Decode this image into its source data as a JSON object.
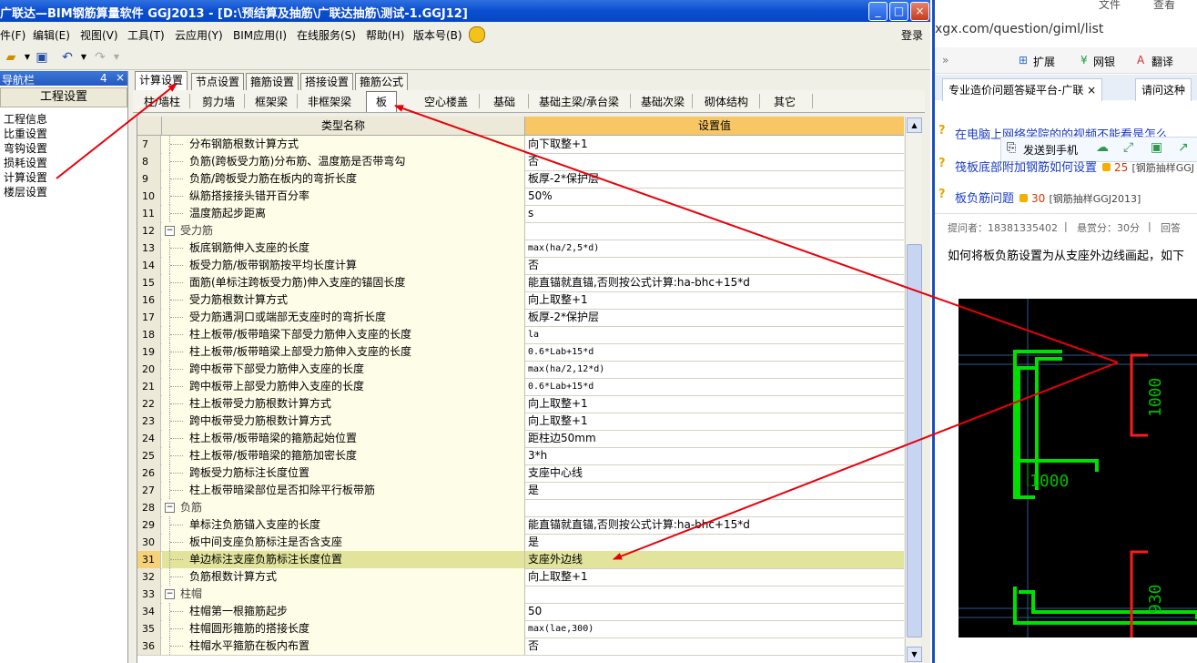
{
  "window": {
    "title": "广联达—BIM钢筋算量软件 GGJ2013 - [D:\\预结算及抽筋\\广联达抽筋\\测试-1.GGJ12]",
    "minimize": "_",
    "maximize": "□",
    "close": "×"
  },
  "menubar": {
    "items": [
      "件(F)",
      "编辑(E)",
      "视图(V)",
      "工具(T)",
      "云应用(Y)",
      "BIM应用(I)",
      "在线服务(S)",
      "帮助(H)",
      "版本号(B)"
    ],
    "login": "登录"
  },
  "nav": {
    "title": "导航栏",
    "pin": "4",
    "close": "×",
    "section": "工程设置",
    "items": [
      "工程信息",
      "比重设置",
      "弯钩设置",
      "损耗设置",
      "计算设置",
      "楼层设置"
    ]
  },
  "tabs": [
    "计算设置",
    "节点设置",
    "箍筋设置",
    "搭接设置",
    "箍筋公式"
  ],
  "subtabs": [
    "柱/墙柱",
    "剪力墙",
    "框架梁",
    "非框架梁",
    "板",
    "空心楼盖",
    "基础",
    "基础主梁/承台梁",
    "基础次梁",
    "砌体结构",
    "其它"
  ],
  "grid": {
    "header_name": "类型名称",
    "header_value": "设置值",
    "rows": [
      {
        "num": "7",
        "name": "分布钢筋根数计算方式",
        "value": "向下取整+1"
      },
      {
        "num": "8",
        "name": "负筋(跨板受力筋)分布筋、温度筋是否带弯勾",
        "value": "否"
      },
      {
        "num": "9",
        "name": "负筋/跨板受力筋在板内的弯折长度",
        "value": "板厚-2*保护层"
      },
      {
        "num": "10",
        "name": "纵筋搭接接头错开百分率",
        "value": "50%"
      },
      {
        "num": "11",
        "name": "温度筋起步距离",
        "value": "s"
      },
      {
        "num": "12",
        "name": "受力筋",
        "value": "",
        "group": true
      },
      {
        "num": "13",
        "name": "板底钢筋伸入支座的长度",
        "value": "max(ha/2,5*d)",
        "mono": true
      },
      {
        "num": "14",
        "name": "板受力筋/板带钢筋按平均长度计算",
        "value": "否"
      },
      {
        "num": "15",
        "name": "面筋(单标注跨板受力筋)伸入支座的锚固长度",
        "value": "能直锚就直锚,否则按公式计算:ha-bhc+15*d"
      },
      {
        "num": "16",
        "name": "受力筋根数计算方式",
        "value": "向上取整+1"
      },
      {
        "num": "17",
        "name": "受力筋遇洞口或端部无支座时的弯折长度",
        "value": "板厚-2*保护层"
      },
      {
        "num": "18",
        "name": "柱上板带/板带暗梁下部受力筋伸入支座的长度",
        "value": "la",
        "mono": true
      },
      {
        "num": "19",
        "name": "柱上板带/板带暗梁上部受力筋伸入支座的长度",
        "value": "0.6*Lab+15*d",
        "mono": true
      },
      {
        "num": "20",
        "name": "跨中板带下部受力筋伸入支座的长度",
        "value": "max(ha/2,12*d)",
        "mono": true
      },
      {
        "num": "21",
        "name": "跨中板带上部受力筋伸入支座的长度",
        "value": "0.6*Lab+15*d",
        "mono": true
      },
      {
        "num": "22",
        "name": "柱上板带受力筋根数计算方式",
        "value": "向上取整+1"
      },
      {
        "num": "23",
        "name": "跨中板带受力筋根数计算方式",
        "value": "向上取整+1"
      },
      {
        "num": "24",
        "name": "柱上板带/板带暗梁的箍筋起始位置",
        "value": "距柱边50mm"
      },
      {
        "num": "25",
        "name": "柱上板带/板带暗梁的箍筋加密长度",
        "value": "3*h"
      },
      {
        "num": "26",
        "name": "跨板受力筋标注长度位置",
        "value": "支座中心线"
      },
      {
        "num": "27",
        "name": "柱上板带暗梁部位是否扣除平行板带筋",
        "value": "是"
      },
      {
        "num": "28",
        "name": "负筋",
        "value": "",
        "group": true
      },
      {
        "num": "29",
        "name": "单标注负筋锚入支座的长度",
        "value": "能直锚就直锚,否则按公式计算:ha-bhc+15*d"
      },
      {
        "num": "30",
        "name": "板中间支座负筋标注是否含支座",
        "value": "是"
      },
      {
        "num": "31",
        "name": "单边标注支座负筋标注长度位置",
        "value": "支座外边线",
        "selected": true
      },
      {
        "num": "32",
        "name": "负筋根数计算方式",
        "value": "向上取整+1"
      },
      {
        "num": "33",
        "name": "柱帽",
        "value": "",
        "group": true
      },
      {
        "num": "34",
        "name": "柱帽第一根箍筋起步",
        "value": "50"
      },
      {
        "num": "35",
        "name": "柱帽圆形箍筋的搭接长度",
        "value": "max(lae,300)",
        "mono": true
      },
      {
        "num": "36",
        "name": "柱帽水平箍筋在板内布置",
        "value": "否"
      }
    ]
  },
  "browser": {
    "menu_file": "文件",
    "menu_view": "查看",
    "url": "xgx.com/question/giml/list",
    "tools": [
      "扩展",
      "网银",
      "翻译"
    ],
    "tabs": [
      "专业造价问题答疑平台-广联",
      "请问这种"
    ],
    "send_to_phone": "发送到手机",
    "questions": [
      {
        "text": "在电脑上网络学院的的视频不能看是怎么",
        "reward": "",
        "tag": ""
      },
      {
        "text": "筏板底部附加钢筋如何设置",
        "reward": "25",
        "tag": "[钢筋抽样GGJ"
      },
      {
        "text": "板负筋问题",
        "reward": "30",
        "tag": "[钢筋抽样GGJ2013]"
      }
    ],
    "asker": "提问者：18381335402",
    "bounty": "悬赏分：30分",
    "answer_label": "回答",
    "question_body": "如何将板负筋设置为从支座外边线画起，如下",
    "cad_dims": [
      "1000",
      "1000",
      "930"
    ]
  },
  "colors": {
    "title_bar": "#0a4fd0",
    "value_header": "#f8c763",
    "selected_row": "#e2e49c",
    "arrow": "#e8000a",
    "cad_green": "#00e000",
    "cad_red": "#ff1a1a"
  }
}
